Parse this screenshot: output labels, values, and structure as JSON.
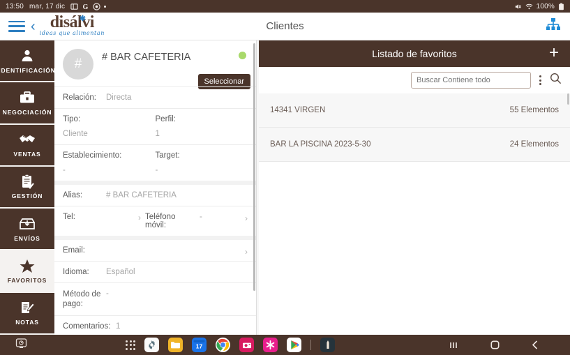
{
  "status_bar": {
    "time": "13:50",
    "date": "mar, 17 dic",
    "icons": [
      "screenshot-icon",
      "google-g-icon",
      "chrome-circle-icon",
      "dot-icon"
    ],
    "mute_icon": "mute-icon",
    "wifi_icon": "wifi-icon",
    "battery_percent": "100%",
    "battery_icon": "battery-full-icon"
  },
  "app_bar": {
    "menu_icon": "hamburger-menu-icon",
    "back_icon": "back-chevron-icon",
    "logo_text": "disálvi",
    "logo_tagline": "ideas que alimentan",
    "title": "Clientes",
    "right_icon": "hierarchy-icon"
  },
  "sidebar": {
    "items": [
      {
        "label": "IDENTIFICACIÓN",
        "icon": "person-icon",
        "active": false
      },
      {
        "label": "NEGOCIACIÓN",
        "icon": "briefcase-icon",
        "active": false
      },
      {
        "label": "VENTAS",
        "icon": "handshake-icon",
        "active": false
      },
      {
        "label": "GESTIÓN",
        "icon": "clipboard-check-icon",
        "active": false
      },
      {
        "label": "ENVÍOS",
        "icon": "shipping-box-icon",
        "active": false
      },
      {
        "label": "FAVORITOS",
        "icon": "star-icon",
        "active": true
      },
      {
        "label": "NOTAS",
        "icon": "notes-pencil-icon",
        "active": false
      }
    ]
  },
  "detail": {
    "avatar_text": "#",
    "title": "# BAR CAFETERIA",
    "status_dot_color": "#a8d96a",
    "select_button": "Seleccionar",
    "fields": {
      "relacion_label": "Relación:",
      "relacion_value": "Directa",
      "tipo_label": "Tipo:",
      "tipo_value": "Cliente",
      "perfil_label": "Perfil:",
      "perfil_value": "1",
      "establecimiento_label": "Establecimiento:",
      "establecimiento_value": "-",
      "target_label": "Target:",
      "target_value": "-",
      "alias_label": "Alias:",
      "alias_value": "# BAR CAFETERIA",
      "tel_label": "Tel:",
      "telefono_movil_label": "Teléfono móvil:",
      "telefono_movil_value": "-",
      "email_label": "Email:",
      "idioma_label": "Idioma:",
      "idioma_value": "Español",
      "metodo_pago_label": "Método de pago:",
      "metodo_pago_value": "-",
      "comentarios_label": "Comentarios:",
      "comentarios_value": "1"
    }
  },
  "favorites": {
    "header_title": "Listado de favoritos",
    "add_icon": "plus-icon",
    "search_placeholder": "Buscar Contiene todo",
    "search_value": "",
    "kebab_icon": "more-options-icon",
    "search_icon": "search-icon",
    "items": [
      {
        "name": "14341 VIRGEN",
        "count": "55 Elementos"
      },
      {
        "name": "BAR LA PISCINA 2023-5-30",
        "count": "24 Elementos"
      }
    ]
  },
  "taskbar": {
    "left_icon": "screen-cast-icon",
    "apps": [
      {
        "name": "app-drawer-icon"
      },
      {
        "name": "settings-gear-icon",
        "color": "#ffffff"
      },
      {
        "name": "files-folder-icon",
        "color": "#f4b400"
      },
      {
        "name": "calendar-icon",
        "label": "17",
        "color": "#1a73e8"
      },
      {
        "name": "chrome-icon",
        "color": "#ffffff"
      },
      {
        "name": "camera-app-icon",
        "color": "#d81b60"
      },
      {
        "name": "snowflake-app-icon",
        "color": "#e91e8c"
      },
      {
        "name": "play-store-icon",
        "color": "#ffffff"
      },
      {
        "name": "pen-app-icon",
        "color": "#263238"
      }
    ],
    "nav": [
      {
        "name": "recents-icon"
      },
      {
        "name": "home-icon"
      },
      {
        "name": "back-icon"
      }
    ]
  },
  "colors": {
    "brand_brown": "#4a342a",
    "accent_blue": "#2e7fc1",
    "status_green": "#a8d96a"
  }
}
